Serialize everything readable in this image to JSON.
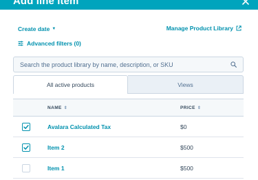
{
  "header": {
    "title": "Add line item"
  },
  "filters": {
    "create_date_label": "Create date",
    "manage_library_label": "Manage Product Library",
    "advanced_filters_label": "Advanced filters (0)"
  },
  "search": {
    "placeholder": "Search the product library by name, description, or SKU"
  },
  "tabs": [
    {
      "label": "All active products",
      "active": true
    },
    {
      "label": "Views",
      "active": false
    }
  ],
  "table": {
    "columns": {
      "name": "NAME",
      "price": "PRICE"
    },
    "rows": [
      {
        "name": "Avalara Calculated Tax",
        "price": "$0",
        "checked": true
      },
      {
        "name": "Item 2",
        "price": "$500",
        "checked": true
      },
      {
        "name": "Item 1",
        "price": "$500",
        "checked": false
      }
    ]
  },
  "colors": {
    "header_bg": "#00a4bd",
    "link": "#0091ae",
    "text": "#33475b"
  }
}
